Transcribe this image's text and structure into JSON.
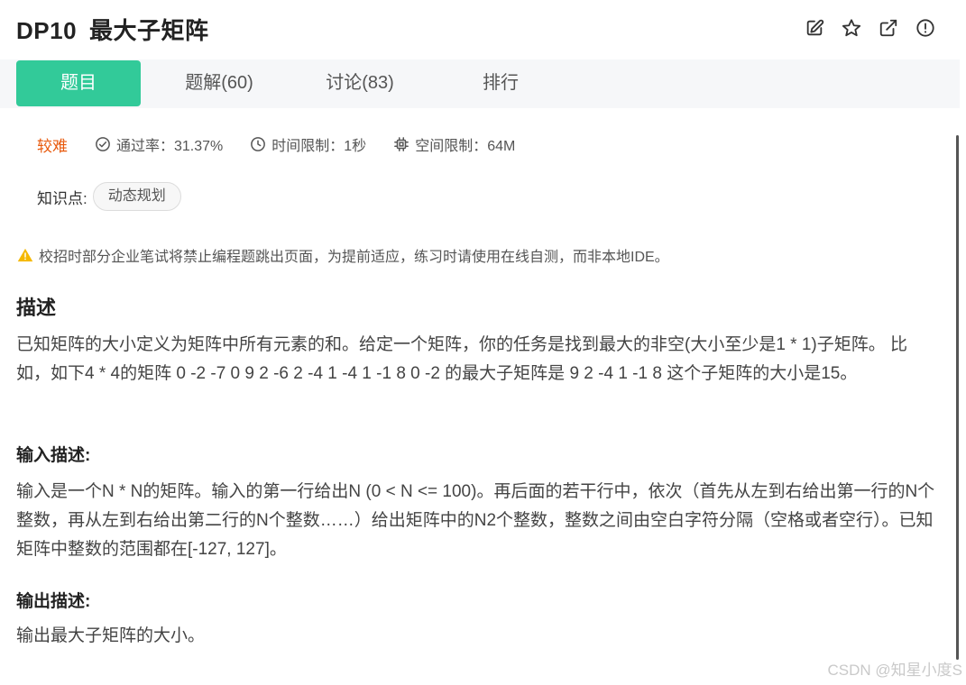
{
  "header": {
    "problem_id": "DP10",
    "problem_title": "最大子矩阵",
    "icons": [
      "edit-icon",
      "star-icon",
      "external-link-icon",
      "alert-circle-icon"
    ]
  },
  "tabs": [
    {
      "label": "题目",
      "active": true
    },
    {
      "label": "题解(60)",
      "active": false
    },
    {
      "label": "讨论(83)",
      "active": false
    },
    {
      "label": "排行",
      "active": false
    }
  ],
  "meta": {
    "difficulty": "较难",
    "pass_rate": "通过率：31.37%",
    "time_limit": "时间限制：1秒",
    "space_limit": "空间限制：64M"
  },
  "knowledge": {
    "label": "知识点:",
    "tag": "动态规划"
  },
  "warning": "校招时部分企业笔试将禁止编程题跳出页面，为提前适应，练习时请使用在线自测，而非本地IDE。",
  "description": {
    "heading": "描述",
    "text": "已知矩阵的大小定义为矩阵中所有元素的和。给定一个矩阵，你的任务是找到最大的非空(大小至少是1 * 1)子矩阵。 比如，如下4 * 4的矩阵 0 -2 -7 0 9 2 -6 2 -4 1 -4 1 -1 8 0 -2 的最大子矩阵是 9 2 -4 1 -1 8 这个子矩阵的大小是15。"
  },
  "input_desc": {
    "heading": "输入描述:",
    "text": "输入是一个N * N的矩阵。输入的第一行给出N (0 < N <= 100)。再后面的若干行中，依次（首先从左到右给出第一行的N个整数，再从左到右给出第二行的N个整数……）给出矩阵中的N2个整数，整数之间由空白字符分隔（空格或者空行）。已知矩阵中整数的范围都在[-127, 127]。"
  },
  "output_desc": {
    "heading": "输出描述:",
    "text": "输出最大子矩阵的大小。"
  },
  "watermark": "CSDN @知星小度S",
  "colors": {
    "accent": "#32ca99",
    "difficulty": "#e8590c",
    "warning": "#f5b800"
  }
}
